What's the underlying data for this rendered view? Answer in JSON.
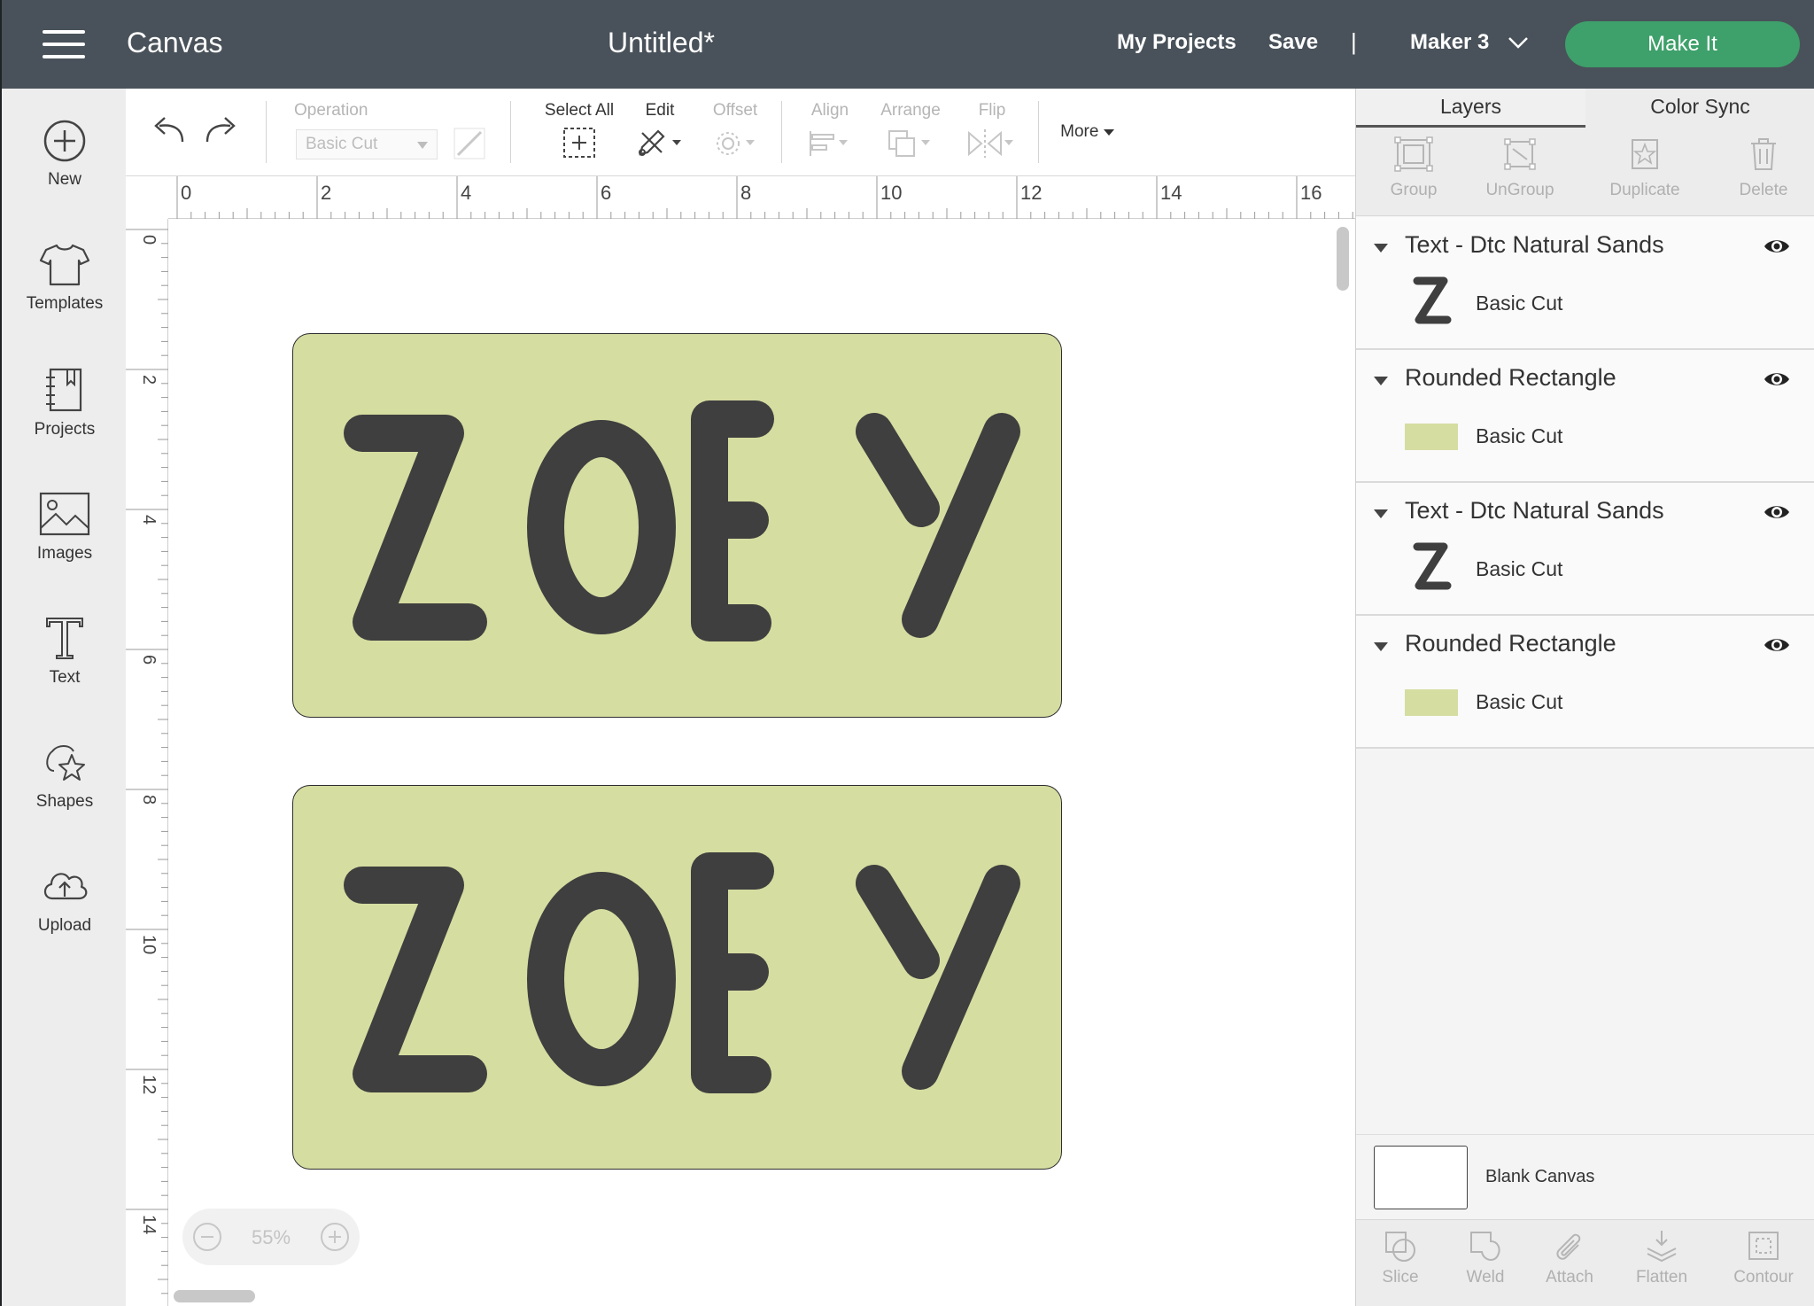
{
  "topbar": {
    "app_title": "Canvas",
    "doc_title": "Untitled*",
    "my_projects": "My Projects",
    "save": "Save",
    "separator": "|",
    "machine": "Maker 3",
    "make_it": "Make It",
    "bg_color": "#49525a",
    "make_it_color": "#3ea06a"
  },
  "sidebar": {
    "items": [
      {
        "label": "New",
        "icon": "plus-circle-icon"
      },
      {
        "label": "Templates",
        "icon": "tshirt-icon"
      },
      {
        "label": "Projects",
        "icon": "notebook-icon"
      },
      {
        "label": "Images",
        "icon": "image-icon"
      },
      {
        "label": "Text",
        "icon": "text-icon"
      },
      {
        "label": "Shapes",
        "icon": "shapes-icon"
      },
      {
        "label": "Upload",
        "icon": "cloud-upload-icon"
      }
    ]
  },
  "toolbar": {
    "operation_label": "Operation",
    "operation_value": "Basic Cut",
    "select_all": "Select All",
    "edit": "Edit",
    "offset": "Offset",
    "align": "Align",
    "arrange": "Arrange",
    "flip": "Flip",
    "more": "More"
  },
  "rulers": {
    "horizontal": [
      "0",
      "2",
      "4",
      "6",
      "8",
      "10",
      "12",
      "14",
      "16"
    ],
    "vertical": [
      "0",
      "2",
      "4",
      "6",
      "8",
      "10",
      "12",
      "14"
    ]
  },
  "canvas": {
    "zoom": "55%",
    "designs": [
      {
        "text": "ZOEY",
        "shape": "Rounded Rectangle",
        "fill": "#d6dda1",
        "text_color": "#3f3f3f"
      },
      {
        "text": "ZOEY",
        "shape": "Rounded Rectangle",
        "fill": "#d6dda1",
        "text_color": "#3f3f3f"
      }
    ]
  },
  "panel": {
    "tabs": [
      "Layers",
      "Color Sync"
    ],
    "actions": [
      "Group",
      "UnGroup",
      "Duplicate",
      "Delete"
    ],
    "layers": [
      {
        "name": "Text - Dtc Natural Sands",
        "operation": "Basic Cut",
        "thumb": "Z"
      },
      {
        "name": "Rounded Rectangle",
        "operation": "Basic Cut",
        "thumb": ""
      },
      {
        "name": "Text - Dtc Natural Sands",
        "operation": "Basic Cut",
        "thumb": "Z"
      },
      {
        "name": "Rounded Rectangle",
        "operation": "Basic Cut",
        "thumb": ""
      }
    ],
    "blank_canvas": "Blank Canvas",
    "bottom_actions": [
      "Slice",
      "Weld",
      "Attach",
      "Flatten",
      "Contour"
    ]
  }
}
